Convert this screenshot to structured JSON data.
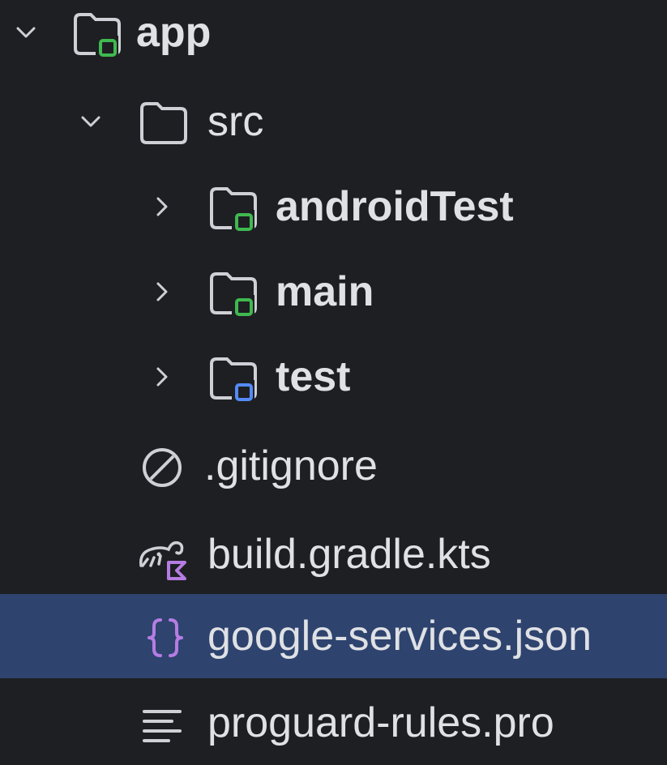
{
  "colors": {
    "background": "#1e1f22",
    "selection": "#2e436e",
    "text": "#dfe1e5",
    "folder_outline": "#ced0d6",
    "module_badge": "#3fb950",
    "test_badge": "#548af7",
    "kotlin_badge": "#b57de3",
    "json_icon": "#b57de3"
  },
  "tree": {
    "items": [
      {
        "label": "app",
        "icon": "module-folder-icon",
        "expanded": true
      },
      {
        "label": "src",
        "icon": "folder-icon",
        "expanded": true
      },
      {
        "label": "androidTest",
        "icon": "source-folder-icon",
        "expanded": false
      },
      {
        "label": "main",
        "icon": "source-folder-icon",
        "expanded": false
      },
      {
        "label": "test",
        "icon": "test-folder-icon",
        "expanded": false
      },
      {
        "label": ".gitignore",
        "icon": "ignore-file-icon"
      },
      {
        "label": "build.gradle.kts",
        "icon": "gradle-kotlin-icon"
      },
      {
        "label": "google-services.json",
        "icon": "json-file-icon",
        "selected": true
      },
      {
        "label": "proguard-rules.pro",
        "icon": "text-file-icon"
      }
    ]
  }
}
